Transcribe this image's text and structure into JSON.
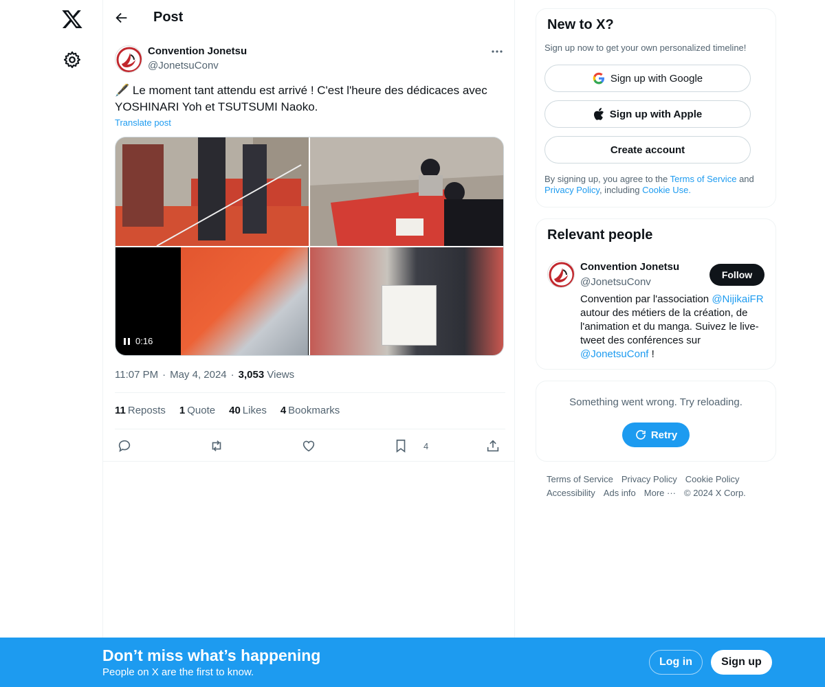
{
  "header": {
    "title": "Post"
  },
  "tweet": {
    "author_name": "Convention Jonetsu",
    "author_handle": "@JonetsuConv",
    "emoji": "🖋️",
    "text": "Le moment tant attendu est arrivé ! C'est l'heure des dédicaces avec YOSHINARI Yoh et TSUTSUMI Naoko.",
    "translate_label": "Translate post",
    "video_duration": "0:16",
    "time": "11:07 PM",
    "date": "May 4, 2024",
    "views_count": "3,053",
    "views_label": "Views",
    "stats": [
      {
        "count": "11",
        "label": "Reposts"
      },
      {
        "count": "1",
        "label": "Quote"
      },
      {
        "count": "40",
        "label": "Likes"
      },
      {
        "count": "4",
        "label": "Bookmarks"
      }
    ],
    "bookmark_count": "4"
  },
  "signup_card": {
    "title": "New to X?",
    "subtitle": "Sign up now to get your own personalized timeline!",
    "google_label": "Sign up with Google",
    "apple_label": "Sign up with Apple",
    "create_label": "Create account",
    "legal_prefix": "By signing up, you agree to the",
    "terms_link": "Terms of Service",
    "legal_and": "and",
    "privacy_link": "Privacy Policy",
    "legal_including": ", including",
    "cookie_link": "Cookie Use."
  },
  "relevant_people": {
    "title": "Relevant people",
    "name": "Convention Jonetsu",
    "handle": "@JonetsuConv",
    "follow_label": "Follow",
    "bio_1": "Convention par l'association",
    "bio_link_1": "@NijikaiFR",
    "bio_2": "autour des métiers de la création, de l'animation et du manga. Suivez le live-tweet des conférences sur",
    "bio_link_2": "@JonetsuConf",
    "bio_3": "!"
  },
  "error_card": {
    "message": "Something went wrong. Try reloading.",
    "retry_label": "Retry"
  },
  "footer": {
    "links": [
      "Terms of Service",
      "Privacy Policy",
      "Cookie Policy",
      "Accessibility",
      "Ads info",
      "More ···",
      "© 2024 X Corp."
    ]
  },
  "bottom_bar": {
    "title": "Don’t miss what’s happening",
    "subtitle": "People on X are the first to know.",
    "login_label": "Log in",
    "signup_label": "Sign up"
  },
  "colors": {
    "accent": "#1d9bf0",
    "text": "#0f1419",
    "muted": "#536471"
  }
}
